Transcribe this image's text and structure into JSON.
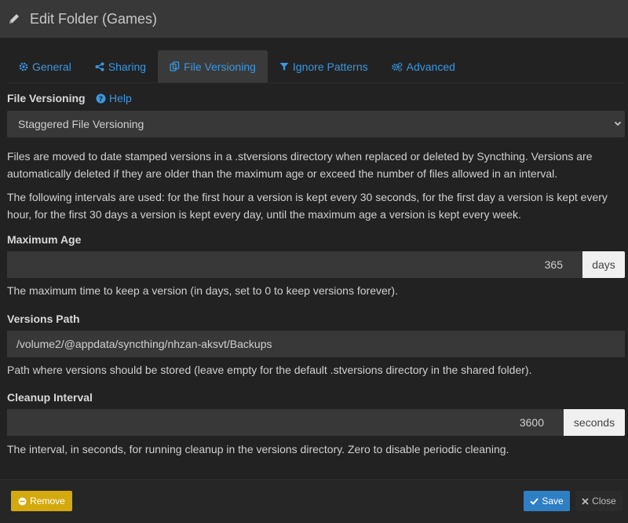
{
  "header": {
    "title": "Edit Folder (Games)",
    "icon": "pencil-icon"
  },
  "tabs": [
    {
      "label": "General",
      "icon": "gear-icon",
      "active": false
    },
    {
      "label": "Sharing",
      "icon": "share-icon",
      "active": false
    },
    {
      "label": "File Versioning",
      "icon": "copy-icon",
      "active": true
    },
    {
      "label": "Ignore Patterns",
      "icon": "filter-icon",
      "active": false
    },
    {
      "label": "Advanced",
      "icon": "gears-icon",
      "active": false
    }
  ],
  "versioning": {
    "label": "File Versioning",
    "help": "Help",
    "selected": "Staggered File Versioning",
    "desc1": "Files are moved to date stamped versions in a .stversions directory when replaced or deleted by Syncthing. Versions are automatically deleted if they are older than the maximum age or exceed the number of files allowed in an interval.",
    "desc2": "The following intervals are used: for the first hour a version is kept every 30 seconds, for the first day a version is kept every hour, for the first 30 days a version is kept every day, until the maximum age a version is kept every week."
  },
  "max_age": {
    "label": "Maximum Age",
    "value": "365",
    "unit": "days",
    "help": "The maximum time to keep a version (in days, set to 0 to keep versions forever)."
  },
  "versions_path": {
    "label": "Versions Path",
    "value": "/volume2/@appdata/syncthing/nhzan-aksvt/Backups",
    "help": "Path where versions should be stored (leave empty for the default .stversions directory in the shared folder)."
  },
  "cleanup": {
    "label": "Cleanup Interval",
    "value": "3600",
    "unit": "seconds",
    "help": "The interval, in seconds, for running cleanup in the versions directory. Zero to disable periodic cleaning."
  },
  "footer": {
    "remove": "Remove",
    "save": "Save",
    "close": "Close"
  },
  "colors": {
    "accent": "#3b97e0",
    "remove": "#d4a90d",
    "save": "#2f7fc4",
    "background": "#222222"
  }
}
